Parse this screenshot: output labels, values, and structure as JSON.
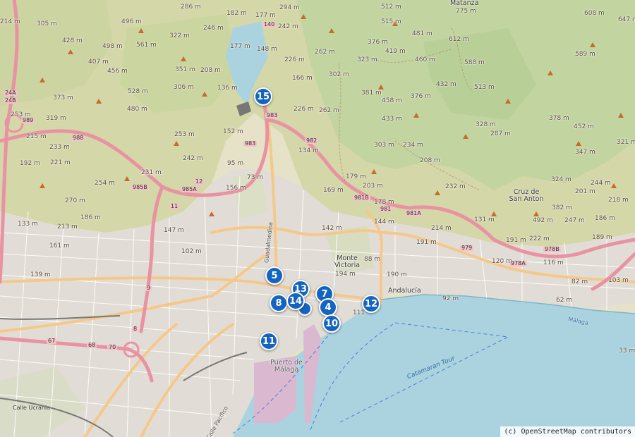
{
  "attribution": "(c) OpenStreetMap contributors",
  "colors": {
    "hill": "#d9dbb0",
    "forest": "#b7cf9c",
    "urban": "#e0dcd6",
    "sea": "#aad3df",
    "motorway": "#e892a2",
    "primary": "#fcd6a4",
    "marker": "#1565c0"
  },
  "markers": [
    {
      "id": "15",
      "label": "15"
    },
    {
      "id": "5",
      "label": "5"
    },
    {
      "id": "13",
      "label": "13"
    },
    {
      "id": "7",
      "label": "7"
    },
    {
      "id": "8",
      "label": "8"
    },
    {
      "id": "14",
      "label": "14"
    },
    {
      "id": "4",
      "label": "4"
    },
    {
      "id": "12",
      "label": "12"
    },
    {
      "id": "10",
      "label": "10"
    },
    {
      "id": "11",
      "label": "11"
    }
  ],
  "places": {
    "matanza": "Matanza",
    "monte_victoria": "Monte Victoria",
    "cruz_san_anton": "Cruz de San Anton",
    "puerto": "Puerto de Málaga",
    "andalucia": "Andalucía",
    "malaga": "Málaga",
    "calle_ucrania": "Calle Ucrania",
    "catamaran": "Catamaran Tour",
    "guadalmedina": "Guadalmedina",
    "calle_pacifico": "Calle Pacífico"
  },
  "roads": [
    "983",
    "982",
    "981",
    "981A",
    "981B",
    "985A",
    "985B",
    "988",
    "989",
    "24A",
    "24B",
    "979",
    "978A",
    "978B",
    "9",
    "8",
    "67",
    "68",
    "70",
    "12",
    "11",
    "140"
  ],
  "elevations": [
    "286 m",
    "305 m",
    "214 m",
    "428 m",
    "496 m",
    "322 m",
    "246 m",
    "182 m",
    "177 m",
    "294 m",
    "242 m",
    "512 m",
    "515 m",
    "608 m",
    "647 m",
    "775 m",
    "498 m",
    "561 m",
    "407 m",
    "456 m",
    "351 m",
    "208 m",
    "177 m",
    "148 m",
    "226 m",
    "262 m",
    "376 m",
    "419 m",
    "481 m",
    "460 m",
    "588 m",
    "589 m",
    "528 m",
    "480 m",
    "306 m",
    "136 m",
    "166 m",
    "302 m",
    "323 m",
    "612 m",
    "432 m",
    "513 m",
    "373 m",
    "253 m",
    "319 m",
    "215 m",
    "233 m",
    "192 m",
    "221 m",
    "254 m",
    "231 m",
    "242 m",
    "253 m",
    "152 m",
    "95 m",
    "73 m",
    "226 m",
    "262 m",
    "381 m",
    "458 m",
    "376 m",
    "433 m",
    "328 m",
    "287 m",
    "378 m",
    "452 m",
    "321 m",
    "134 m",
    "303 m",
    "234 m",
    "208 m",
    "347 m",
    "179 m",
    "169 m",
    "203 m",
    "232 m",
    "324 m",
    "244 m",
    "201 m",
    "218 m",
    "270 m",
    "186 m",
    "156 m",
    "147 m",
    "133 m",
    "213 m",
    "178 m",
    "144 m",
    "214 m",
    "131 m",
    "222 m",
    "382 m",
    "492 m",
    "247 m",
    "186 m",
    "161 m",
    "102 m",
    "142 m",
    "191 m",
    "120 m",
    "191 m",
    "116 m",
    "189 m",
    "139 m",
    "88 m",
    "190 m",
    "82 m",
    "103 m",
    "62 m",
    "194 m",
    "92 m",
    "33 m",
    "111",
    "1",
    "231 m"
  ]
}
